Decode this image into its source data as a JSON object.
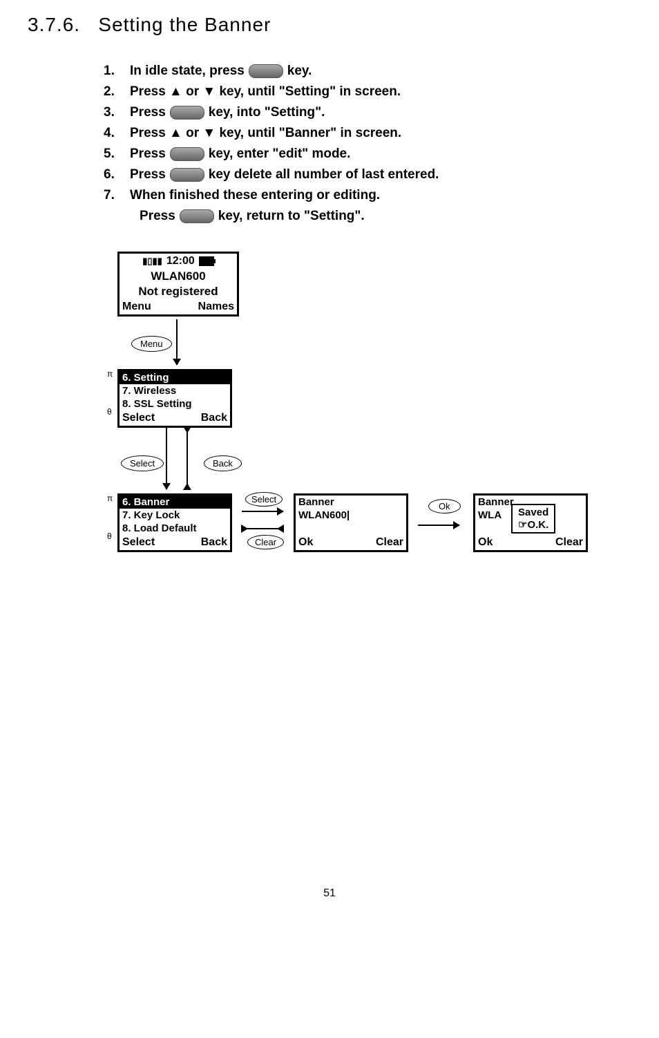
{
  "section": {
    "number": "3.7.6.",
    "title": "Setting the Banner"
  },
  "instructions": {
    "item1_num": "1.",
    "item1_a": "In idle state, press",
    "item1_b": "key.",
    "item2_num": "2.",
    "item2": "Press ▲ or ▼ key, until \"Setting\" in screen.",
    "item3_num": "3.",
    "item3_a": "Press",
    "item3_b": "key, into \"Setting\".",
    "item4_num": "4.",
    "item4": "Press ▲ or ▼ key, until \"Banner\" in screen.",
    "item5_num": "5.",
    "item5_a": "Press",
    "item5_b": "key, enter \"edit\" mode.",
    "item6_num": "6.",
    "item6_a": "Press",
    "item6_b": "key delete all number of last entered.",
    "item7_num": "7.",
    "item7": "When finished these entering or editing.",
    "item7c_a": "Press",
    "item7c_b": "key, return to \"Setting\"."
  },
  "screens": {
    "idle": {
      "time": "12:00",
      "banner": "WLAN600",
      "status": "Not registered",
      "left_softkey": "Menu",
      "right_softkey": "Names"
    },
    "menu1": {
      "item1": "6. Setting",
      "item2": "7. Wireless",
      "item3": "8. SSL Setting",
      "left_softkey": "Select",
      "right_softkey": "Back"
    },
    "menu2": {
      "item1": "6. Banner",
      "item2": "7. Key Lock",
      "item3": "8. Load Default",
      "left_softkey": "Select",
      "right_softkey": "Back"
    },
    "edit": {
      "title": "Banner",
      "value": "WLAN600|",
      "left_softkey": "Ok",
      "right_softkey": "Clear"
    },
    "saved": {
      "title": "Banner",
      "value": "WLA",
      "left_softkey": "Ok",
      "right_softkey": "Clear",
      "popup_line1": "Saved",
      "popup_line2": "☞O.K."
    }
  },
  "buttons": {
    "menu": "Menu",
    "select": "Select",
    "back": "Back",
    "clear": "Clear",
    "ok": "Ok"
  },
  "scroll": {
    "up": "π",
    "down": "θ"
  },
  "page_number": "51"
}
